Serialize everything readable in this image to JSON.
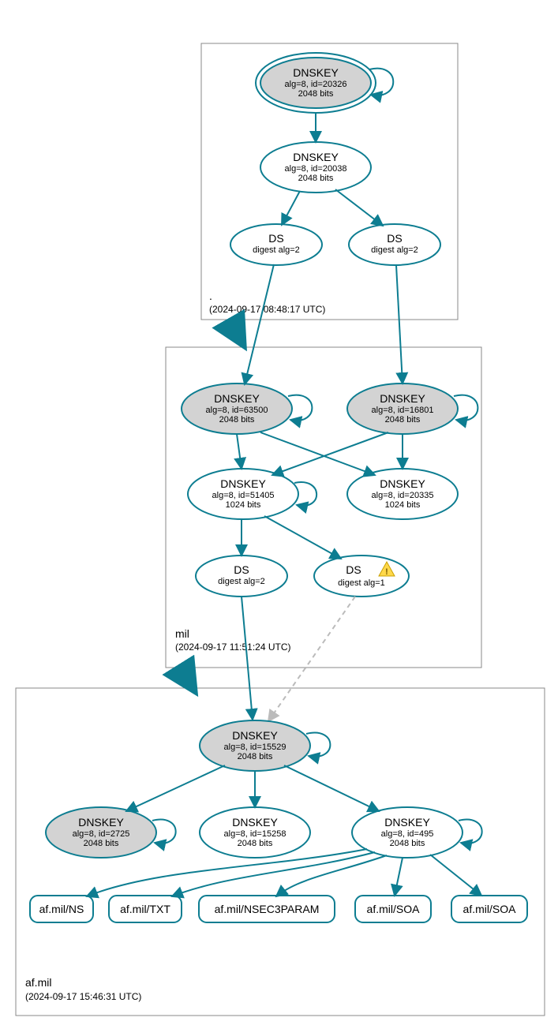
{
  "zones": {
    "root": {
      "name": ".",
      "timestamp": "(2024-09-17 08:48:17 UTC)"
    },
    "mil": {
      "name": "mil",
      "timestamp": "(2024-09-17 11:51:24 UTC)"
    },
    "afmil": {
      "name": "af.mil",
      "timestamp": "(2024-09-17 15:46:31 UTC)"
    }
  },
  "nodes": {
    "root_ksk": {
      "title": "DNSKEY",
      "line1": "alg=8, id=20326",
      "line2": "2048 bits"
    },
    "root_zsk": {
      "title": "DNSKEY",
      "line1": "alg=8, id=20038",
      "line2": "2048 bits"
    },
    "root_ds1": {
      "title": "DS",
      "line1": "digest alg=2"
    },
    "root_ds2": {
      "title": "DS",
      "line1": "digest alg=2"
    },
    "mil_ksk1": {
      "title": "DNSKEY",
      "line1": "alg=8, id=63500",
      "line2": "2048 bits"
    },
    "mil_ksk2": {
      "title": "DNSKEY",
      "line1": "alg=8, id=16801",
      "line2": "2048 bits"
    },
    "mil_zsk1": {
      "title": "DNSKEY",
      "line1": "alg=8, id=51405",
      "line2": "1024 bits"
    },
    "mil_zsk2": {
      "title": "DNSKEY",
      "line1": "alg=8, id=20335",
      "line2": "1024 bits"
    },
    "mil_ds1": {
      "title": "DS",
      "line1": "digest alg=2"
    },
    "mil_ds2": {
      "title": "DS",
      "line1": "digest alg=1"
    },
    "af_ksk": {
      "title": "DNSKEY",
      "line1": "alg=8, id=15529",
      "line2": "2048 bits"
    },
    "af_k1": {
      "title": "DNSKEY",
      "line1": "alg=8, id=2725",
      "line2": "2048 bits"
    },
    "af_k2": {
      "title": "DNSKEY",
      "line1": "alg=8, id=15258",
      "line2": "2048 bits"
    },
    "af_k3": {
      "title": "DNSKEY",
      "line1": "alg=8, id=495",
      "line2": "2048 bits"
    },
    "rr_ns": {
      "label": "af.mil/NS"
    },
    "rr_txt": {
      "label": "af.mil/TXT"
    },
    "rr_nsec3": {
      "label": "af.mil/NSEC3PARAM"
    },
    "rr_soa1": {
      "label": "af.mil/SOA"
    },
    "rr_soa2": {
      "label": "af.mil/SOA"
    }
  },
  "colors": {
    "stroke": "#0d7d91",
    "gray": "#d3d3d3"
  }
}
